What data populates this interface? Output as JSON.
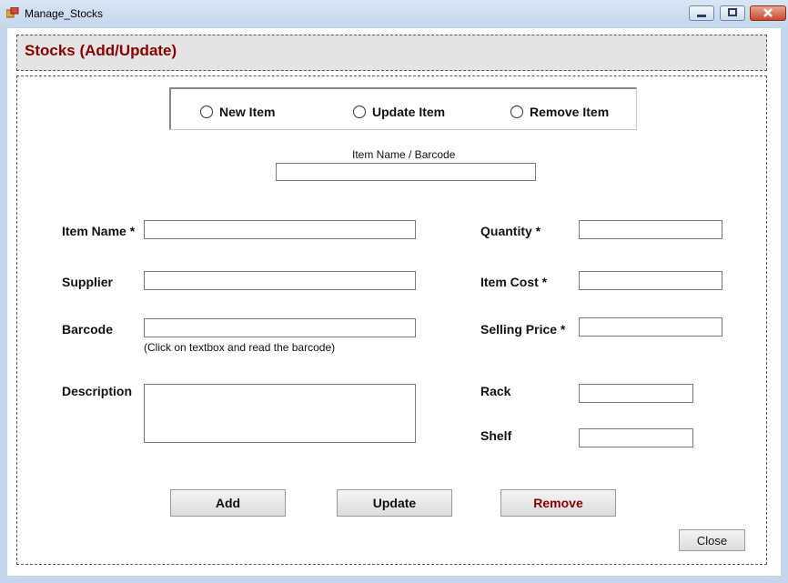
{
  "window": {
    "title": "Manage_Stocks"
  },
  "header": {
    "title": "Stocks (Add/Update)"
  },
  "mode": {
    "options": [
      "New Item",
      "Update Item",
      "Remove Item"
    ]
  },
  "search": {
    "label": "Item Name / Barcode",
    "value": ""
  },
  "form": {
    "item_name_label": "Item Name *",
    "supplier_label": "Supplier",
    "barcode_label": "Barcode",
    "barcode_hint": "(Click on textbox and read the barcode)",
    "description_label": "Description",
    "quantity_label": "Quantity *",
    "item_cost_label": "Item Cost *",
    "selling_price_label": "Selling Price *",
    "rack_label": "Rack",
    "shelf_label": "Shelf"
  },
  "actions": {
    "add": "Add",
    "update": "Update",
    "remove": "Remove",
    "close": "Close"
  },
  "colors": {
    "header_title": "#8b0000",
    "remove_button_text": "#8b0000"
  }
}
